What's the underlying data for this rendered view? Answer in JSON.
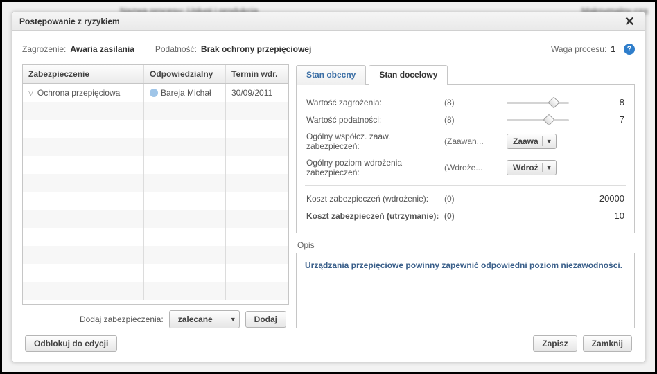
{
  "bg": {
    "label": "Nazwa procesu:",
    "value": "Usługi i produkcja",
    "right": "Maksymalny cza"
  },
  "dialog": {
    "title": "Postępowanie z ryzykiem",
    "close_glyph": "✕"
  },
  "header": {
    "zagrozenie_label": "Zagrożenie:",
    "zagrozenie_value": "Awaria zasilania",
    "podatnosc_label": "Podatność:",
    "podatnosc_value": "Brak ochrony przepięciowej",
    "waga_label": "Waga procesu:",
    "waga_value": "1",
    "help_glyph": "?"
  },
  "grid": {
    "col1": "Zabezpieczenie",
    "col2": "Odpowiedzialny",
    "col3": "Termin wdr.",
    "row": {
      "zab": "Ochrona przepięciowa",
      "odp": "Bareja Michał",
      "term": "30/09/2011"
    }
  },
  "addrow": {
    "label": "Dodaj zabezpieczenia:",
    "dropdown": "zalecane",
    "button": "Dodaj"
  },
  "tabs": {
    "t1": "Stan obecny",
    "t2": "Stan docelowy"
  },
  "panel": {
    "r1_label": "Wartość zagrożenia:",
    "r1_paren": "(8)",
    "r1_val": "8",
    "r2_label": "Wartość podatności:",
    "r2_paren": "(8)",
    "r2_val": "7",
    "r3_label": "Ogólny współcz. zaaw. zabezpieczeń:",
    "r3_paren": "(Zaawan...",
    "r3_dd": "Zaawa",
    "r4_label": "Ogólny poziom wdrożenia zabezpieczeń:",
    "r4_paren": "(Wdroże...",
    "r4_dd": "Wdroż",
    "r5_label": "Koszt zabezpieczeń (wdrożenie):",
    "r5_paren": "(0)",
    "r5_val": "20000",
    "r6_label": "Koszt zabezpieczeń (utrzymanie):",
    "r6_paren": "(0)",
    "r6_val": "10"
  },
  "opis": {
    "label": "Opis",
    "text": "Urządzania przepięciowe powinny zapewnić odpowiedni poziom niezawodności."
  },
  "footer": {
    "unlock": "Odblokuj do edycji",
    "save": "Zapisz",
    "close": "Zamknij"
  }
}
